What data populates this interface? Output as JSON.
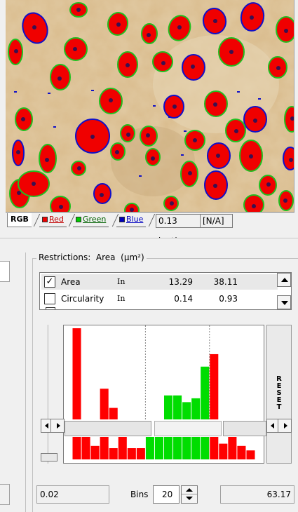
{
  "tabs": {
    "rgb": "RGB",
    "red": "Red",
    "green": "Green",
    "blue": "Blue",
    "scale": "0.13 µm/px",
    "status": "[N/A]"
  },
  "colors": {
    "red_channel": "#ee0000",
    "green_channel": "#00cc00",
    "blue_channel": "#0000bb",
    "histogram_selected": "#00dd00",
    "histogram_unselected": "#ff0000",
    "tissue_background": "#d8b98a"
  },
  "icons": {
    "checkbox_checked": "✓",
    "scroll_up": "arrow-up-icon",
    "scroll_down": "arrow-down-icon",
    "scroll_left": "arrow-left-icon",
    "scroll_right": "arrow-right-icon"
  },
  "restrictions": {
    "label": "Restrictions:  Area  (µm²)",
    "rows": [
      {
        "checked": true,
        "name": "Area",
        "mode": "In",
        "low": "13.29",
        "high": "38.11"
      },
      {
        "checked": false,
        "name": "Circularity",
        "mode": "In",
        "low": "0.14",
        "high": "0.93"
      }
    ]
  },
  "histogram": {
    "reset_label": "RESET",
    "selection": {
      "low_bin": 8,
      "high_bin": 14
    }
  },
  "chart_data": {
    "type": "bar",
    "bins": 20,
    "values": [
      95,
      0,
      0,
      32,
      12,
      0,
      0,
      0,
      0,
      0,
      25,
      25,
      18,
      22,
      55,
      68,
      0,
      0,
      0,
      0
    ],
    "selected_range": [
      13.29,
      38.11
    ]
  },
  "footer": {
    "min_value": "0.02",
    "bins_label": "Bins",
    "bins_value": "20",
    "max_value": "63.17"
  }
}
